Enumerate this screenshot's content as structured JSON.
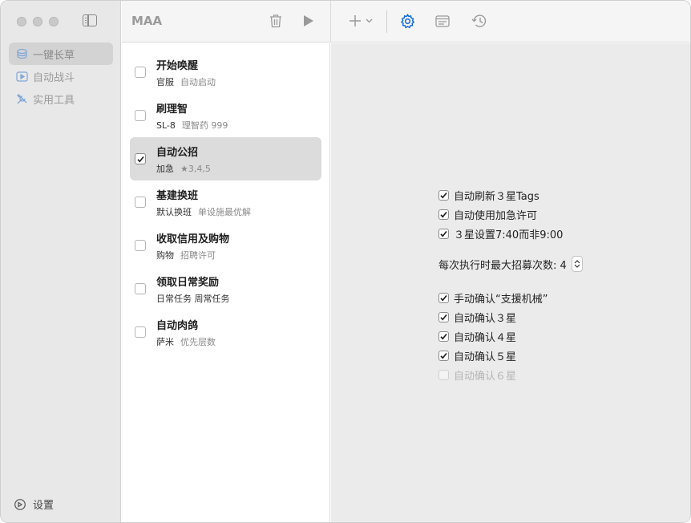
{
  "app": {
    "title": "MAA"
  },
  "sidebar": {
    "items": [
      {
        "label": "一键长草",
        "icon": "stack-icon",
        "active": true
      },
      {
        "label": "自动战斗",
        "icon": "play-square-icon",
        "active": false
      },
      {
        "label": "实用工具",
        "icon": "tools-icon",
        "active": false
      }
    ],
    "settings_label": "设置"
  },
  "toolbar": {
    "delete_icon": "trash-icon",
    "start_icon": "play-icon",
    "add_icon": "plus-icon",
    "settings_icon": "gear-icon",
    "log_icon": "log-window-icon",
    "history_icon": "history-icon",
    "accent_color": "#0a64d6"
  },
  "tasks": [
    {
      "title": "开始唤醒",
      "sub1": "官服",
      "sub2": "自动启动",
      "checked": false,
      "selected": false
    },
    {
      "title": "刷理智",
      "sub1": "SL-8",
      "sub2": "理智药 999",
      "checked": false,
      "selected": false
    },
    {
      "title": "自动公招",
      "sub1": "加急",
      "sub2": "★3,4,5",
      "checked": true,
      "selected": true
    },
    {
      "title": "基建换班",
      "sub1": "默认换班",
      "sub2": "单设施最优解",
      "checked": false,
      "selected": false
    },
    {
      "title": "收取信用及购物",
      "sub1": "购物",
      "sub2": "招聘许可",
      "checked": false,
      "selected": false
    },
    {
      "title": "领取日常奖励",
      "sub1": "日常任务 周常任务",
      "sub2": "",
      "checked": false,
      "selected": false
    },
    {
      "title": "自动肉鸽",
      "sub1": "萨米",
      "sub2": "优先层数",
      "checked": false,
      "selected": false
    }
  ],
  "detail": {
    "options_top": [
      {
        "label": "自动刷新３星Tags",
        "checked": true
      },
      {
        "label": "自动使用加急许可",
        "checked": true
      },
      {
        "label": "３星设置7:40而非9:00",
        "checked": true
      }
    ],
    "stepper_label": "每次执行时最大招募次数: 4",
    "options_bottom": [
      {
        "label": "手动确认“支援机械”",
        "checked": true,
        "disabled": false
      },
      {
        "label": "自动确认３星",
        "checked": true,
        "disabled": false
      },
      {
        "label": "自动确认４星",
        "checked": true,
        "disabled": false
      },
      {
        "label": "自动确认５星",
        "checked": true,
        "disabled": false
      },
      {
        "label": "自动确认６星",
        "checked": false,
        "disabled": true
      }
    ]
  }
}
